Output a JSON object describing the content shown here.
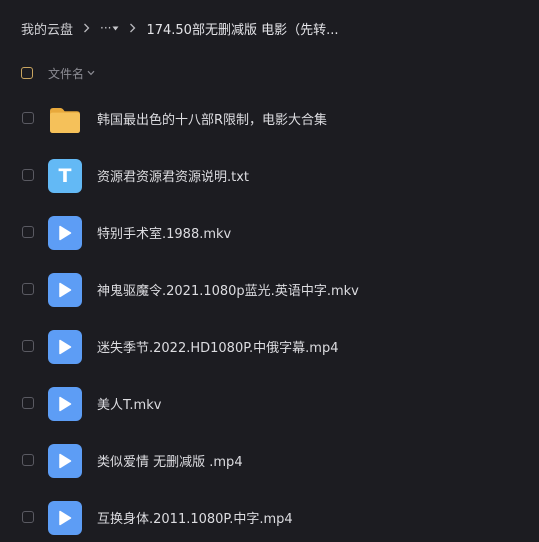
{
  "breadcrumb": {
    "root": "我的云盘",
    "more": "···",
    "current": "174.50部无删减版 电影（先转..."
  },
  "list_header": {
    "column_label": "文件名"
  },
  "files": [
    {
      "name": "韩国最出色的十八部R限制，电影大合集",
      "type": "folder"
    },
    {
      "name": "资源君资源君资源说明.txt",
      "type": "text",
      "glyph": "T"
    },
    {
      "name": "特别手术室.1988.mkv",
      "type": "video"
    },
    {
      "name": "神鬼驱魔令.2021.1080p蓝光.英语中字.mkv",
      "type": "video"
    },
    {
      "name": "迷失季节.2022.HD1080P.中俄字幕.mp4",
      "type": "video"
    },
    {
      "name": "美人T.mkv",
      "type": "video"
    },
    {
      "name": "类似爱情 无删减版 .mp4",
      "type": "video"
    },
    {
      "name": "互换身体.2011.1080P.中字.mp4",
      "type": "video"
    }
  ],
  "colors": {
    "background": "#1c1c21",
    "folder": "#f5c15a",
    "video_icon": "#5d9df5",
    "text_icon": "#63b9f5"
  }
}
